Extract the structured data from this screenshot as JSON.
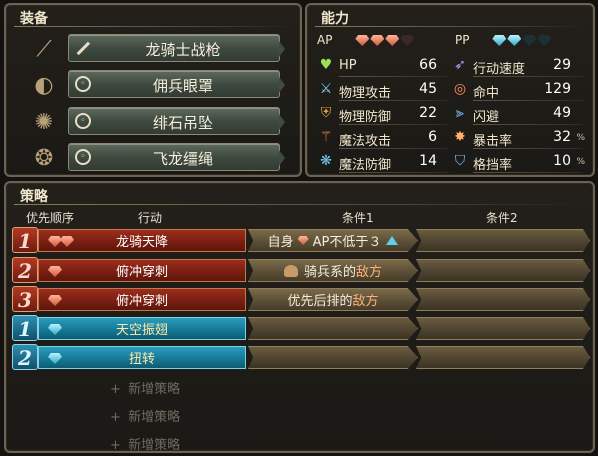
{
  "equipment": {
    "title": "装备",
    "items": [
      {
        "name": "龙骑士战枪",
        "icon": "spear-icon"
      },
      {
        "name": "佣兵眼罩",
        "icon": "ring-slot-icon"
      },
      {
        "name": "绯石吊坠",
        "icon": "ring-slot-icon"
      },
      {
        "name": "飞龙缰绳",
        "icon": "ring-slot-icon"
      }
    ]
  },
  "abilities": {
    "title": "能力",
    "ap_label": "AP",
    "pp_label": "PP",
    "ap": {
      "filled": 3,
      "total": 4
    },
    "pp": {
      "filled": 2,
      "total": 4
    },
    "left": [
      {
        "label": "HP",
        "value": "66",
        "unit": ""
      },
      {
        "label": "物理攻击",
        "value": "45",
        "unit": ""
      },
      {
        "label": "物理防御",
        "value": "22",
        "unit": ""
      },
      {
        "label": "魔法攻击",
        "value": "6",
        "unit": ""
      },
      {
        "label": "魔法防御",
        "value": "14",
        "unit": ""
      }
    ],
    "right": [
      {
        "label": "行动速度",
        "value": "29",
        "unit": ""
      },
      {
        "label": "命中",
        "value": "129",
        "unit": ""
      },
      {
        "label": "闪避",
        "value": "49",
        "unit": ""
      },
      {
        "label": "暴击率",
        "value": "32",
        "unit": "%"
      },
      {
        "label": "格挡率",
        "value": "10",
        "unit": "%"
      }
    ]
  },
  "strategy": {
    "title": "策略",
    "headers": {
      "priority": "优先顺序",
      "action": "行动",
      "cond1": "条件1",
      "cond2": "条件2"
    },
    "rows": [
      {
        "num": "1",
        "type": "red",
        "action": "龙骑天降",
        "cond1_prefix": "自身",
        "cond1_main": "AP不低于３",
        "cond1_hl": "",
        "cond2": ""
      },
      {
        "num": "2",
        "type": "red",
        "action": "俯冲穿刺",
        "cond1_prefix": "",
        "cond1_main": "骑兵系的",
        "cond1_hl": "敌方",
        "cond2": ""
      },
      {
        "num": "3",
        "type": "red",
        "action": "俯冲穿刺",
        "cond1_prefix": "",
        "cond1_main": "优先后排的",
        "cond1_hl": "敌方",
        "cond2": ""
      },
      {
        "num": "1",
        "type": "blue",
        "action": "天空振翅",
        "cond1_prefix": "",
        "cond1_main": "",
        "cond1_hl": "",
        "cond2": ""
      },
      {
        "num": "2",
        "type": "blue",
        "action": "扭转",
        "cond1_prefix": "",
        "cond1_main": "",
        "cond1_hl": "",
        "cond2": ""
      }
    ],
    "add_label": "新增策略",
    "add_plus": "+"
  },
  "colors": {
    "ap_gem": "#d2573b",
    "pp_gem": "#35a8c6",
    "red_row": "#7a1f12",
    "blue_row": "#167a98",
    "highlight": "#ffb07a"
  }
}
